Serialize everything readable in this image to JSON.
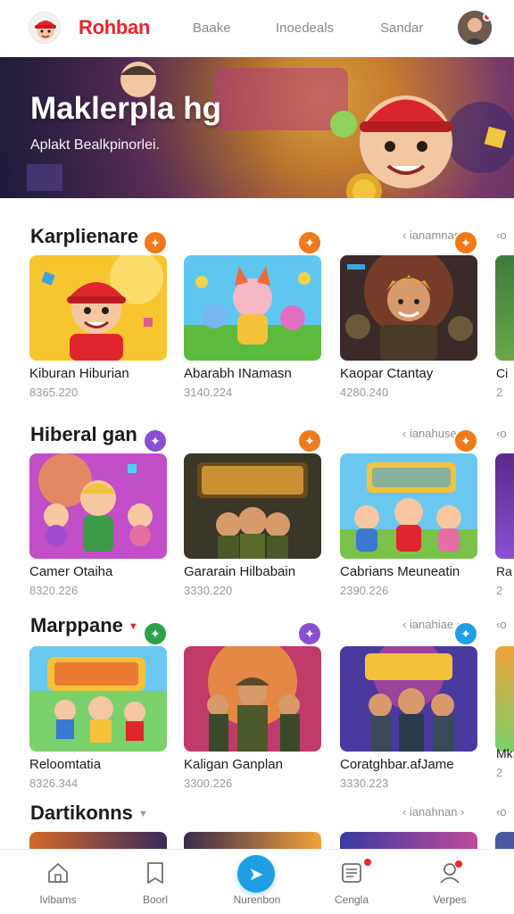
{
  "header": {
    "brand": "Rohban",
    "nav": [
      "Baake",
      "Inoedeals",
      "Sandar"
    ],
    "accent": "#e5252a"
  },
  "hero": {
    "title": "Maklerpla hg",
    "subtitle": "Aplakt Bealkpinorlei."
  },
  "sections": [
    {
      "title": "Karplienare",
      "link": "‹ ianamnas ›",
      "peek_link": "‹o",
      "cards": [
        {
          "name": "Kiburan Hiburian",
          "price": "8365.220",
          "badge_color": "#f07a1a",
          "badge_icon": "spark-icon"
        },
        {
          "name": "Abarabh INamasn",
          "price": "3140.224",
          "badge_color": "#f07a1a",
          "badge_icon": "spark-icon"
        },
        {
          "name": "Kaopar Ctantay",
          "price": "4280.240",
          "badge_color": "#f07a1a",
          "badge_icon": "spark-icon"
        }
      ],
      "peek_name": "Ci",
      "peek_price": "2"
    },
    {
      "title": "Hiberal gan",
      "link": "‹ ianahuse ›",
      "peek_link": "‹o",
      "cards": [
        {
          "name": "Camer Otaiha",
          "price": "8320.226",
          "badge_color": "#8a4fd0",
          "badge_icon": "spark-icon"
        },
        {
          "name": "Gararain Hilbabain",
          "price": "3330.220",
          "badge_color": "#f07a1a",
          "badge_icon": "spark-icon"
        },
        {
          "name": "Cabrians Meuneatin",
          "price": "2390.226",
          "badge_color": "#f07a1a",
          "badge_icon": "spark-icon"
        }
      ],
      "peek_name": "Ra",
      "peek_price": "2"
    },
    {
      "title": "Marppane",
      "link": "‹ ianahiae ›",
      "peek_link": "‹o",
      "cards": [
        {
          "name": "Reloomtatia",
          "price": "8326.344",
          "badge_color": "#2ea24a",
          "badge_icon": "spark-icon"
        },
        {
          "name": "Kaligan Ganplan",
          "price": "3300.226",
          "badge_color": "#8a4fd0",
          "badge_icon": "spark-icon"
        },
        {
          "name": "Coratghbar.afJame",
          "price": "3330.223",
          "badge_color": "#1f9ee3",
          "badge_icon": "spark-icon"
        }
      ],
      "peek_name": "Mk",
      "peek_price": "2"
    },
    {
      "title": "Dartikonns",
      "link": "‹ ianahnan ›",
      "peek_link": "‹o"
    }
  ],
  "bottom_nav": [
    {
      "label": "Ivlbams",
      "icon": "home-icon"
    },
    {
      "label": "Boorl",
      "icon": "bookmark-icon"
    },
    {
      "label": "Nurenbon",
      "icon": "play-icon"
    },
    {
      "label": "Cengla",
      "icon": "document-icon"
    },
    {
      "label": "Verpes",
      "icon": "profile-icon"
    }
  ]
}
